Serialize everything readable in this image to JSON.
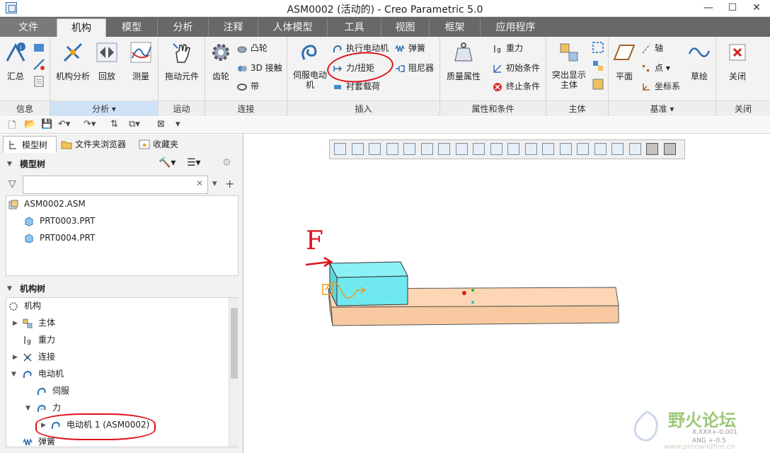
{
  "window": {
    "title": "ASM0002 (活动的) - Creo Parametric 5.0",
    "minimize": "—",
    "maximize": "☐",
    "close": "✕"
  },
  "tabs": [
    "文件",
    "机构",
    "模型",
    "分析",
    "注释",
    "人体模型",
    "工具",
    "视图",
    "框架",
    "应用程序"
  ],
  "ribbon": {
    "info": {
      "label": "信息",
      "summary": "汇总"
    },
    "analysis": {
      "label": "分析 ▾",
      "mech_analysis": "机构分析",
      "playback": "回放",
      "measure": "测量"
    },
    "motion": {
      "label": "运动",
      "drag": "拖动元件"
    },
    "connections": {
      "label": "连接",
      "gear": "齿轮",
      "cam": "凸轮",
      "contact3d": "3D 接触",
      "belt": "带"
    },
    "insert": {
      "label": "插入",
      "servo": "伺服电动机",
      "exec_motor": "执行电动机",
      "force_torque": "力/扭矩",
      "bushing": "衬套载荷",
      "spring": "弹簧",
      "damper": "阻尼器"
    },
    "props": {
      "label": "属性和条件",
      "mass": "质量属性",
      "gravity": "重力",
      "initial": "初始条件",
      "terminate": "终止条件"
    },
    "body": {
      "label": "主体",
      "highlight": "突出显示主体"
    },
    "datum": {
      "label": "基准 ▾",
      "plane": "平面",
      "axis": "轴",
      "point": "点 ▾",
      "csys": "坐标系",
      "sketch": "草绘"
    },
    "close": {
      "label": "关闭",
      "close": "关闭"
    }
  },
  "left_tabs": [
    "模型树",
    "文件夹浏览器",
    "收藏夹"
  ],
  "model_tree": {
    "header": "模型树",
    "items": [
      "ASM0002.ASM",
      "PRT0003.PRT",
      "PRT0004.PRT"
    ]
  },
  "mech_tree": {
    "header": "机构树",
    "items": [
      "机构",
      "主体",
      "重力",
      "连接",
      "电动机",
      "伺服",
      "力",
      "电动机 1 (ASM0002)",
      "弹簧"
    ]
  },
  "annotation": {
    "force_label": "F"
  },
  "watermark": {
    "brand": "野火论坛",
    "line1": "X.XXX+-0.001",
    "line2": "ANG +-0.5",
    "site": "www.proewildfire.cn"
  },
  "colors": {
    "ribbon_bg": "#f3f3f3",
    "tab_bar": "#686868",
    "block": "#6fe8f0",
    "plate": "#fbd3b2",
    "annot_red": "#e0101a"
  }
}
